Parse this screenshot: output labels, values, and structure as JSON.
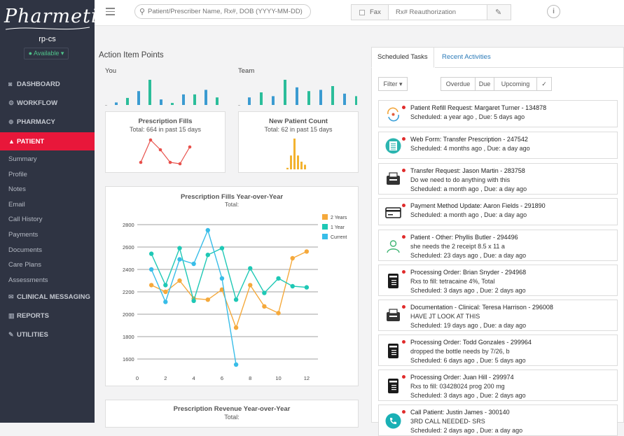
{
  "app": {
    "logo_text": "Pharmetika",
    "user": "rp-cs",
    "status": "Available"
  },
  "nav": {
    "items": [
      {
        "id": "dashboard",
        "label": "DASHBOARD",
        "icon": "dashboard-icon",
        "glyph": "◙"
      },
      {
        "id": "workflow",
        "label": "WORKFLOW",
        "icon": "workflow-icon",
        "glyph": "⚙"
      },
      {
        "id": "pharmacy",
        "label": "PHARMACY",
        "icon": "pharmacy-icon",
        "glyph": "⊕"
      },
      {
        "id": "patient",
        "label": "PATIENT",
        "icon": "user-icon",
        "glyph": "▲"
      }
    ],
    "subitems": [
      "Summary",
      "Profile",
      "Notes",
      "Email",
      "Call History",
      "Payments",
      "Documents",
      "Care Plans",
      "Assessments"
    ],
    "bottom": [
      {
        "id": "clinical-messaging",
        "label": "CLINICAL MESSAGING",
        "icon": "envelope-icon",
        "glyph": "✉"
      },
      {
        "id": "reports",
        "label": "REPORTS",
        "icon": "bar-chart-icon",
        "glyph": "▥"
      },
      {
        "id": "utilities",
        "label": "UTILITIES",
        "icon": "wrench-icon",
        "glyph": "✎"
      }
    ]
  },
  "topbar": {
    "search_placeholder": "Patient/Prescriber Name, Rx#, DOB (YYYY-MM-DD)",
    "fax_label": "Fax",
    "reauth_placeholder": "Rx# Reauthorization",
    "info_glyph": "i"
  },
  "aip": {
    "title": "Action Item Points",
    "you_label": "You",
    "team_label": "Team",
    "you_bars": [
      0.1,
      0.28,
      0.55,
      1.0,
      0.22,
      0.08,
      0.42,
      0.42,
      0.6,
      0.3,
      0.35
    ],
    "team_bars": [
      0.3,
      0.5,
      0.35,
      1.0,
      0.7,
      0.55,
      0.6,
      0.75,
      0.45,
      0.35
    ]
  },
  "cards": {
    "fills": {
      "title": "Prescription Fills",
      "subtitle": "Total: 664 in past 15 days",
      "line": [
        0.1,
        0.9,
        0.55,
        0.1,
        0.05,
        0.65
      ]
    },
    "patients": {
      "title": "New Patient Count",
      "subtitle": "Total: 62 in past 15 days",
      "bars": [
        0.05,
        0.45,
        1.0,
        0.45,
        0.25,
        0.15
      ]
    }
  },
  "chart_data": {
    "type": "line",
    "title": "Prescription Fills Year-over-Year",
    "subtitle": "Total:",
    "x": [
      1,
      2,
      3,
      4,
      5,
      6,
      7,
      8,
      9,
      10,
      11,
      12
    ],
    "xticks": [
      "0",
      "2",
      "4",
      "6",
      "8",
      "10",
      "12"
    ],
    "yticks": [
      "1600",
      "1800",
      "2000",
      "2200",
      "2400",
      "2600",
      "2800"
    ],
    "ylim": [
      1500,
      2900
    ],
    "xlim": [
      0,
      12.8
    ],
    "legend_position": "right",
    "series": [
      {
        "name": "2 Years",
        "color": "#f5a93b",
        "values": [
          2260,
          2200,
          2300,
          2140,
          2130,
          2220,
          1880,
          2260,
          2070,
          2010,
          2500,
          2560
        ]
      },
      {
        "name": "1 Year",
        "color": "#1ec8b5",
        "values": [
          2540,
          2260,
          2590,
          2120,
          2530,
          2590,
          2130,
          2410,
          2190,
          2320,
          2250,
          2240
        ]
      },
      {
        "name": "Current",
        "color": "#38bde8",
        "values": [
          2400,
          2110,
          2490,
          2450,
          2750,
          2320,
          1550,
          null,
          null,
          null,
          null,
          null
        ]
      }
    ]
  },
  "revenue": {
    "title": "Prescription Revenue Year-over-Year",
    "subtitle": "Total:"
  },
  "tasks_panel": {
    "tabs": [
      "Scheduled Tasks",
      "Recent Activities"
    ],
    "filter_label": "Filter",
    "filter_buttons": [
      "Overdue",
      "Due",
      "Upcoming",
      "✓"
    ],
    "tasks": [
      {
        "icon": "refill-icon",
        "title": "Patient Refill Request: Margaret Turner - 134878",
        "lines": [
          "Scheduled: a year ago , Due: 5 days ago"
        ]
      },
      {
        "icon": "web-form-icon",
        "title": "Web Form: Transfer Prescription - 247542",
        "lines": [
          "Scheduled: 4 months ago , Due: a day ago"
        ]
      },
      {
        "icon": "fax-machine-icon",
        "title": "Transfer Request: Jason Martin - 283758",
        "lines": [
          "Do we need to do anything with this",
          "Scheduled: a month ago , Due: a day ago"
        ]
      },
      {
        "icon": "credit-card-icon",
        "title": "Payment Method Update: Aaron Fields - 291890",
        "lines": [
          "Scheduled: a month ago , Due: a day ago"
        ]
      },
      {
        "icon": "patient-icon",
        "title": "Patient - Other: Phyllis Butler - 294496",
        "lines": [
          "she needs the 2 receipt 8.5 x 11 a",
          "Scheduled: 23 days ago , Due: a day ago"
        ]
      },
      {
        "icon": "prescription-icon",
        "title": "Processing Order: Brian Snyder - 294968",
        "lines": [
          "Rxs to fill: tetracaine 4%,   Total",
          "Scheduled: 3 days ago , Due: 2 days ago"
        ]
      },
      {
        "icon": "fax-machine-icon",
        "title": "Documentation - Clinical: Teresa Harrison - 296008",
        "lines": [
          "HAVE JT LOOK AT THIS",
          "Scheduled: 19 days ago , Due: a day ago"
        ]
      },
      {
        "icon": "prescription-icon",
        "title": "Processing Order: Todd Gonzales - 299964",
        "lines": [
          "dropped the bottle needs by 7/26, b",
          "Scheduled: 6 days ago , Due: 5 days ago"
        ]
      },
      {
        "icon": "prescription-icon",
        "title": "Processing Order: Juan Hill - 299974",
        "lines": [
          "Rxs to fill:  03428024 prog 200 mg",
          "Scheduled: 3 days ago , Due: 2 days ago"
        ]
      },
      {
        "icon": "phone-call-icon",
        "title": "Call Patient: Justin James - 300140",
        "lines": [
          "3RD CALL NEEDED- SRS",
          "Scheduled: 2 days ago , Due: a day ago"
        ]
      }
    ]
  }
}
